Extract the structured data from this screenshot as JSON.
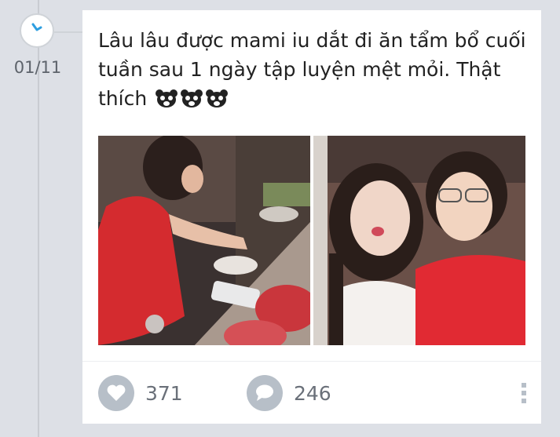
{
  "timeline": {
    "date": "01/11"
  },
  "post": {
    "text": "Lâu lâu được mami iu dắt đi ăn tẩm bổ cuối tuần sau 1 ngày tập luyện mệt mỏi. Thật thích",
    "emoji_icons": [
      "bear-sticker-icon",
      "bear-sticker-icon",
      "bear-sticker-icon"
    ],
    "photos": [
      "photo-girl-eating-hotpot",
      "photo-selfie-with-mother"
    ]
  },
  "actions": {
    "likes": "371",
    "comments": "246",
    "like_icon": "heart-icon",
    "comment_icon": "speech-bubble-icon",
    "more_icon": "more-vertical-icon"
  },
  "colors": {
    "accent_clock": "#2d9ee0",
    "icon_gray": "#b7bfc8",
    "background": "#dde0e6"
  }
}
